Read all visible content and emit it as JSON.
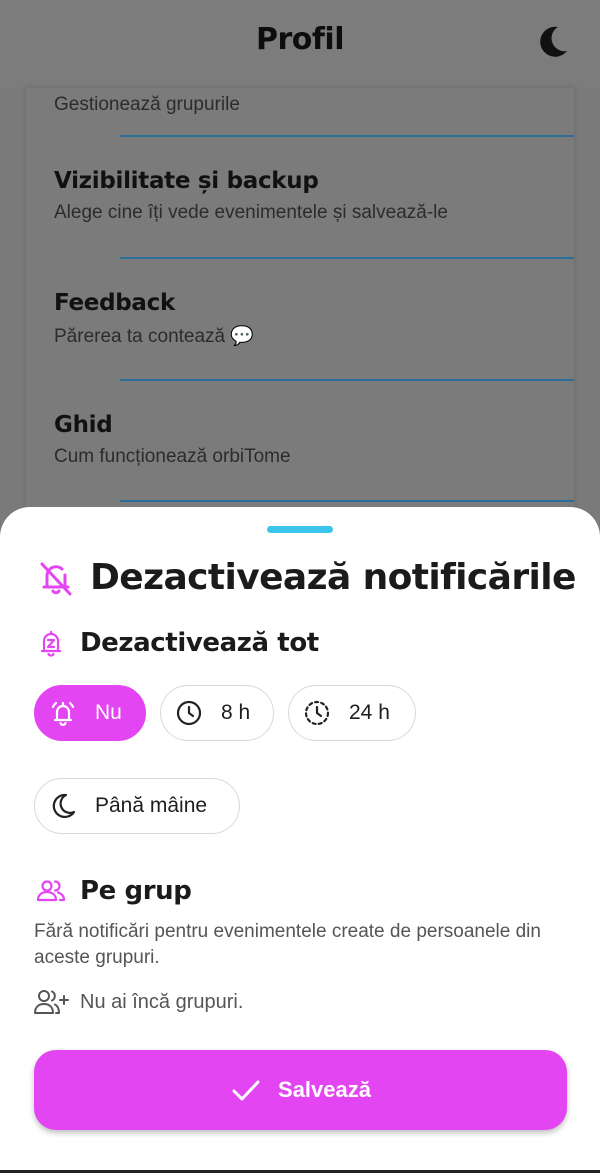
{
  "app_bar": {
    "title": "Profil",
    "theme_icon": "moon-icon"
  },
  "menu": {
    "items": [
      {
        "title": "",
        "subtitle": "Gestionează grupurile"
      },
      {
        "title": "Vizibilitate și backup",
        "subtitle": "Alege cine îți vede evenimentele și salvează-le"
      },
      {
        "title": "Feedback",
        "subtitle": "Părerea ta contează 💬"
      },
      {
        "title": "Ghid",
        "subtitle": "Cum funcționează orbiTome"
      }
    ]
  },
  "sheet": {
    "title": "Dezactivează notificările",
    "title_icon": "bell-off-icon",
    "all_section": {
      "title": "Dezactivează tot",
      "icon": "bell-z-icon",
      "options": [
        {
          "label": "Nu",
          "icon": "bell-ring-icon",
          "selected": true
        },
        {
          "label": "8 h",
          "icon": "clock-icon",
          "selected": false
        },
        {
          "label": "24 h",
          "icon": "clock-dashed-icon",
          "selected": false
        },
        {
          "label": "Până mâine",
          "icon": "moon-icon",
          "selected": false
        }
      ]
    },
    "group_section": {
      "title": "Pe grup",
      "icon": "group-icon",
      "description": "Fără notificări pentru evenimentele create de persoanele din aceste grupuri.",
      "empty_text": "Nu ai încă grupuri.",
      "empty_icon": "add-person-icon"
    },
    "save_label": "Salvează",
    "save_icon": "check-icon"
  },
  "colors": {
    "accent": "#e445f2",
    "handle": "#3cc5ea",
    "divider": "#2a6e99",
    "scrim": "#7a7a7a"
  }
}
